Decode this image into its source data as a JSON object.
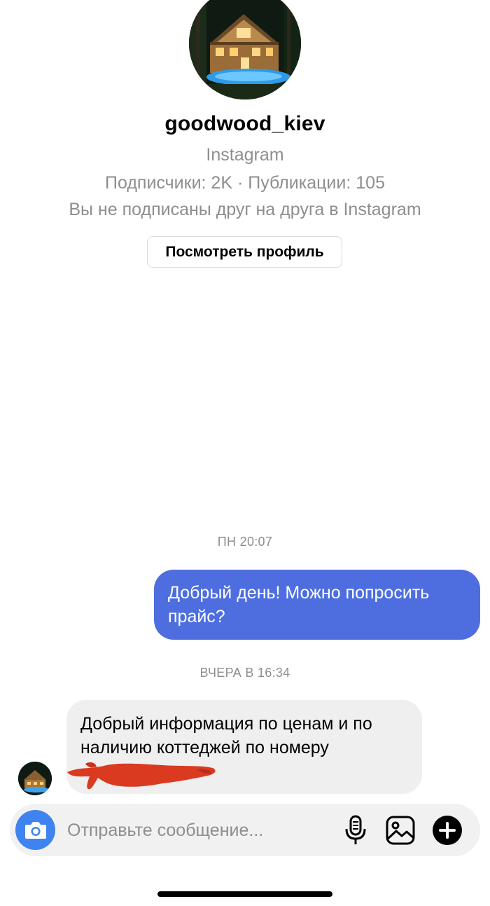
{
  "profile": {
    "username": "goodwood_kiev",
    "source": "Instagram",
    "stats": "Подписчики: 2K · Публикации: 105",
    "follow_note": "Вы не подписаны друг на друга в Instagram",
    "view_profile_label": "Посмотреть профиль"
  },
  "messages": [
    {
      "timestamp": "ПН 20:07",
      "direction": "outgoing",
      "text": "Добрый день! Можно попросить прайс?"
    },
    {
      "timestamp": "ВЧЕРА В 16:34",
      "direction": "incoming",
      "text": "Добрый информация по ценам и по наличию коттеджей по номеру"
    }
  ],
  "composer": {
    "placeholder": "Отправьте сообщение...",
    "icons": [
      "camera-icon",
      "microphone-icon",
      "gallery-icon",
      "plus-icon"
    ]
  },
  "colors": {
    "outgoing_bubble": "#4e6ee0",
    "incoming_bubble": "#efefef",
    "camera_button": "#3f83f0",
    "redaction_scribble": "#d93a20"
  }
}
